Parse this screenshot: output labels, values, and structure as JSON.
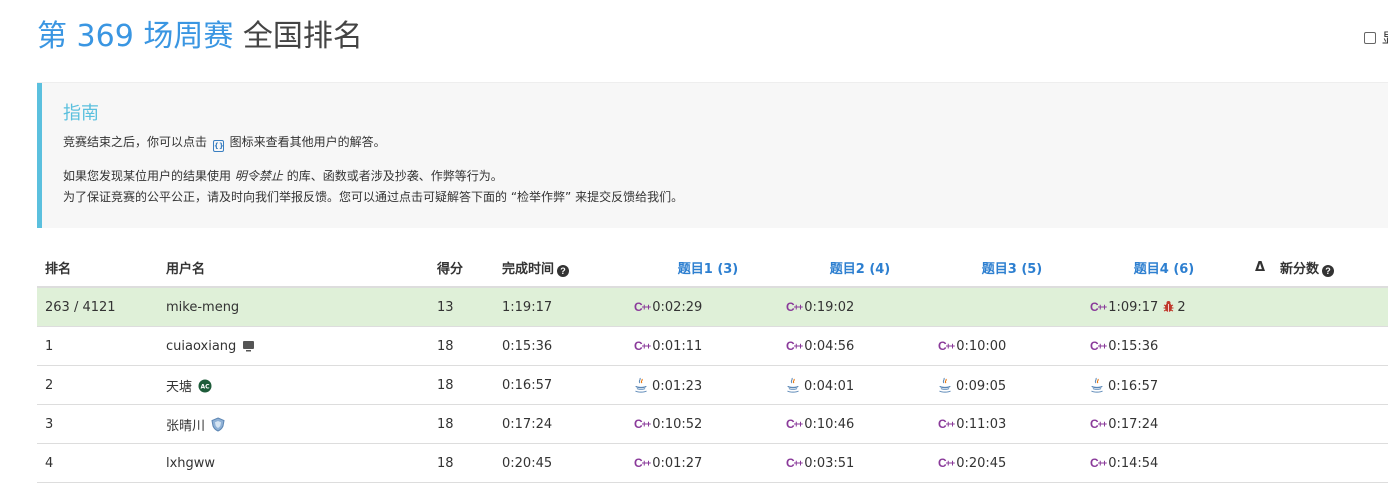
{
  "header": {
    "contest_name": "第 369 场周赛",
    "title_rest": "全国排名",
    "corner_label": "显"
  },
  "guide": {
    "title": "指南",
    "line1_pre": "竞赛结束之后，你可以点击",
    "line1_post": "图标来查看其他用户的解答。",
    "line2_pre": "如果您发现某位用户的结果使用",
    "line2_em": "明令禁止",
    "line2_post": "的库、函数或者涉及抄袭、作弊等行为。",
    "line3": "为了保证竞赛的公平公正，请及时向我们举报反馈。您可以通过点击可疑解答下面的 “检举作弊” 来提交反馈给我们。"
  },
  "table": {
    "headers": {
      "rank": "排名",
      "user": "用户名",
      "score": "得分",
      "finish_time": "完成时间",
      "q1": "题目1 (3)",
      "q2": "题目2 (4)",
      "q3": "题目3 (5)",
      "q4": "题目4 (6)",
      "delta": "Δ",
      "new_score": "新分数"
    },
    "rows": [
      {
        "rank": "263 / 4121",
        "user": "mike-meng",
        "score": "13",
        "time": "1:19:17",
        "q1": "0:02:29",
        "q2": "0:19:02",
        "q3": "",
        "q4": "1:09:17",
        "q4_bugs": "2",
        "lang": [
          "cpp",
          "cpp",
          "",
          "cpp"
        ],
        "badge": ""
      },
      {
        "rank": "1",
        "user": "cuiaoxiang",
        "score": "18",
        "time": "0:15:36",
        "q1": "0:01:11",
        "q2": "0:04:56",
        "q3": "0:10:00",
        "q4": "0:15:36",
        "lang": [
          "cpp",
          "cpp",
          "cpp",
          "cpp"
        ],
        "badge": "monitor"
      },
      {
        "rank": "2",
        "user": "天塘",
        "score": "18",
        "time": "0:16:57",
        "q1": "0:01:23",
        "q2": "0:04:01",
        "q3": "0:09:05",
        "q4": "0:16:57",
        "lang": [
          "java",
          "java",
          "java",
          "java"
        ],
        "badge": "ac"
      },
      {
        "rank": "3",
        "user": "张晴川",
        "score": "18",
        "time": "0:17:24",
        "q1": "0:10:52",
        "q2": "0:10:46",
        "q3": "0:11:03",
        "q4": "0:17:24",
        "lang": [
          "cpp",
          "cpp",
          "cpp",
          "cpp"
        ],
        "badge": "shield"
      },
      {
        "rank": "4",
        "user": "lxhgww",
        "score": "18",
        "time": "0:20:45",
        "q1": "0:01:27",
        "q2": "0:03:51",
        "q3": "0:20:45",
        "q4": "0:14:54",
        "lang": [
          "cpp",
          "cpp",
          "cpp",
          "cpp"
        ],
        "badge": ""
      }
    ]
  },
  "colors": {
    "accent": "#3a96e2",
    "guide_border": "#5bc0de",
    "my_row": "#dff0d8",
    "cpp": "#8a3a9a"
  }
}
